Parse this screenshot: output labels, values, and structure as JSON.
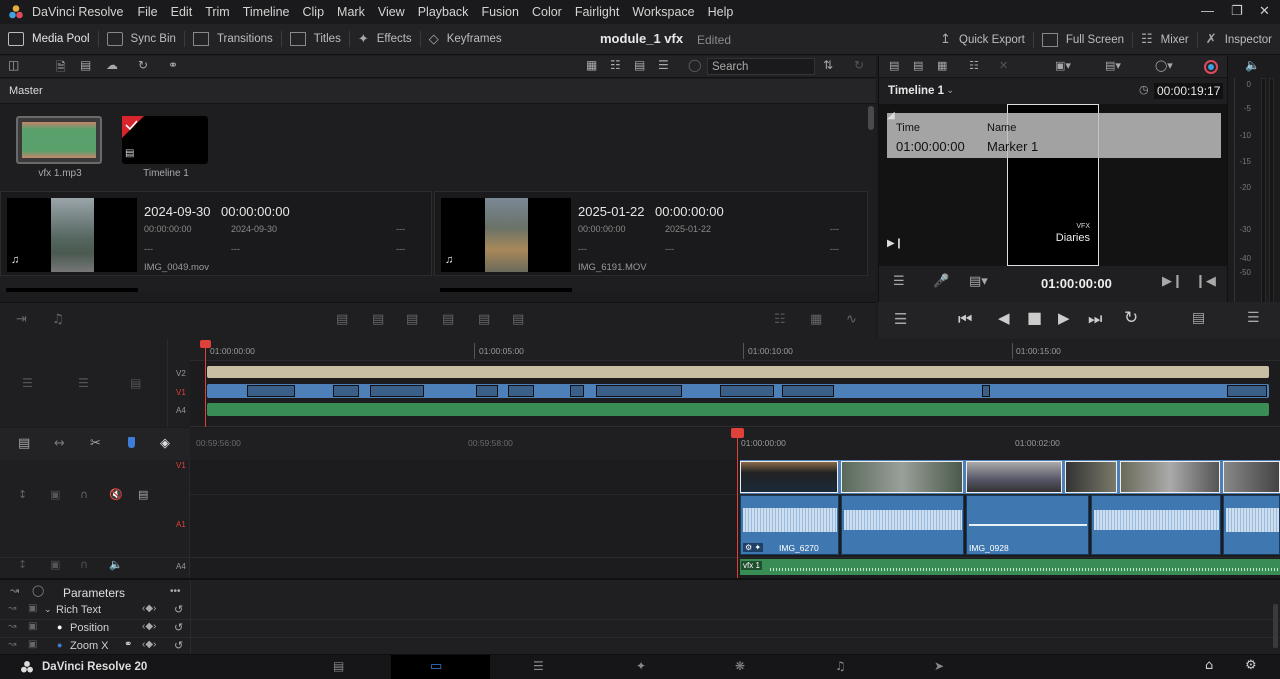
{
  "menubar": {
    "app_name": "DaVinci Resolve",
    "items": [
      "File",
      "Edit",
      "Trim",
      "Timeline",
      "Clip",
      "Mark",
      "View",
      "Playback",
      "Fusion",
      "Color",
      "Fairlight",
      "Workspace",
      "Help"
    ]
  },
  "toolbar": {
    "media_pool": "Media Pool",
    "sync_bin": "Sync Bin",
    "transitions": "Transitions",
    "titles": "Titles",
    "effects": "Effects",
    "keyframes": "Keyframes",
    "project_title": "module_1 vfx",
    "project_status": "Edited",
    "quick_export": "Quick Export",
    "full_screen": "Full Screen",
    "mixer": "Mixer",
    "inspector": "Inspector"
  },
  "media_pool": {
    "search_placeholder": "Search",
    "bin_name": "Master",
    "top_items": [
      {
        "label": "vfx 1.mp3"
      },
      {
        "label": "Timeline 1"
      }
    ],
    "clips": [
      {
        "date": "2024-09-30",
        "tc": "00:00:00:00",
        "tc_small": "00:00:00:00",
        "date_small": "2024-09-30",
        "dash1": "---",
        "dash2": "---",
        "dash3": "---",
        "dash4": "---",
        "name": "IMG_0049.mov"
      },
      {
        "date": "2025-01-22",
        "tc": "00:00:00:00",
        "tc_small": "00:00:00:00",
        "date_small": "2025-01-22",
        "dash1": "---",
        "dash2": "---",
        "dash3": "---",
        "dash4": "---",
        "name": "IMG_6191.MOV"
      }
    ]
  },
  "viewer": {
    "timeline_name": "Timeline 1",
    "duration": "00:00:19:17",
    "marker_col_time": "Time",
    "marker_col_name": "Name",
    "marker_time": "01:00:00:00",
    "marker_name": "Marker 1",
    "overlay_small": "VFX",
    "overlay_big": "Diaries",
    "current_tc": "01:00:00:00"
  },
  "vu_labels": [
    "0",
    "-5",
    "-10",
    "-15",
    "-20",
    "-30",
    "-40",
    "-50"
  ],
  "mini_timeline": {
    "ruler": [
      "01:00:00:00",
      "01:00:05:00",
      "01:00:10:00",
      "01:00:15:00"
    ],
    "tracks": [
      "V2",
      "V1",
      "A4"
    ]
  },
  "timeline": {
    "ruler": [
      "00:59:56:00",
      "00:59:58:00",
      "01:00:00:00",
      "01:00:02:00"
    ],
    "track_v1": "V1",
    "track_a1": "A1",
    "track_a4": "A4",
    "clip_a1": "IMG_6270",
    "clip_a2": "IMG_0928",
    "clip_a4": "vfx 1"
  },
  "params": {
    "title": "Parameters",
    "more": "•••",
    "rows": [
      "Rich Text",
      "Position",
      "Zoom X"
    ]
  },
  "bottombar": {
    "brand": "DaVinci Resolve 20"
  },
  "colors": {
    "accent": "#e0403a",
    "video_clip": "#4d7fb8",
    "audio_clip": "#3f78b0",
    "audio_green": "#3a8c55",
    "title_clip": "#c8bea4"
  }
}
